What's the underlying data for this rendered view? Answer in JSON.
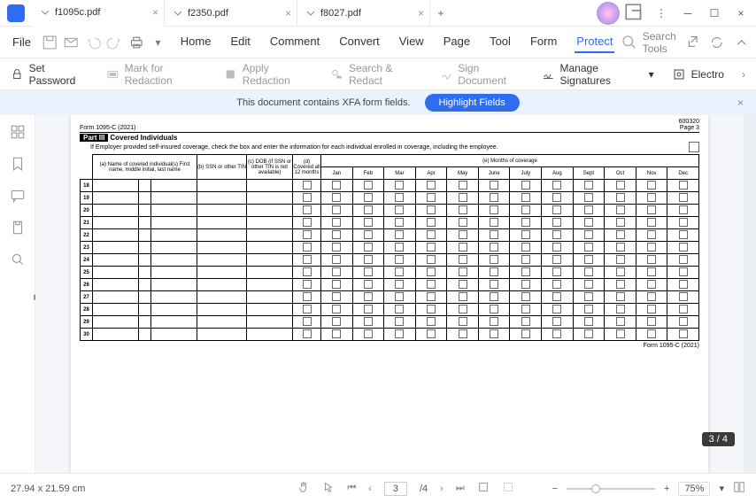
{
  "tabs": [
    {
      "label": "f1095c.pdf",
      "active": true
    },
    {
      "label": "f2350.pdf",
      "active": false
    },
    {
      "label": "f8027.pdf",
      "active": false
    }
  ],
  "menubar": {
    "file": "File",
    "items": [
      "Home",
      "Edit",
      "Comment",
      "Convert",
      "View",
      "Page",
      "Tool",
      "Form",
      "Protect"
    ],
    "active": "Protect",
    "search_placeholder": "Search Tools"
  },
  "toolbar": {
    "items": [
      {
        "label": "Set Password",
        "enabled": true,
        "icon": "lock"
      },
      {
        "label": "Mark for Redaction",
        "enabled": false,
        "icon": "mark"
      },
      {
        "label": "Apply Redaction",
        "enabled": false,
        "icon": "apply"
      },
      {
        "label": "Search & Redact",
        "enabled": false,
        "icon": "search-redact"
      },
      {
        "label": "Sign Document",
        "enabled": false,
        "icon": "sign"
      },
      {
        "label": "Manage Signatures",
        "enabled": true,
        "icon": "sig",
        "dropdown": true
      },
      {
        "label": "Electro",
        "enabled": true,
        "icon": "cert"
      }
    ]
  },
  "xfa": {
    "message": "This document contains XFA form fields.",
    "button": "Highlight Fields"
  },
  "form": {
    "doc_id": "Form 1095-C (2021)",
    "void_code": "600320",
    "page_label": "Page 3",
    "part_label": "Part III",
    "part_title": "Covered Individuals",
    "part_desc": "If Employer provided self-insured coverage, check the box and enter the information for each individual enrolled in coverage, including the employee.",
    "headers": {
      "a": "(a) Name of covered individual(s)\nFirst name, middle initial, last name",
      "b": "(b) SSN or other TIN",
      "c": "(c) DOB (if SSN or other TIN is not available)",
      "d": "(d) Covered all 12 months",
      "e": "(e) Months of coverage"
    },
    "months": [
      "Jan",
      "Feb",
      "Mar",
      "Apr",
      "May",
      "June",
      "July",
      "Aug",
      "Sept",
      "Oct",
      "Nov",
      "Dec"
    ],
    "rows": [
      18,
      19,
      20,
      21,
      22,
      23,
      24,
      25,
      26,
      27,
      28,
      29,
      30
    ],
    "footer": "Form 1095-C (2021)"
  },
  "status": {
    "dimensions": "27.94 x 21.59 cm",
    "page_current": "3",
    "page_total": "/4",
    "zoom": "75%",
    "page_badge": "3 / 4"
  }
}
